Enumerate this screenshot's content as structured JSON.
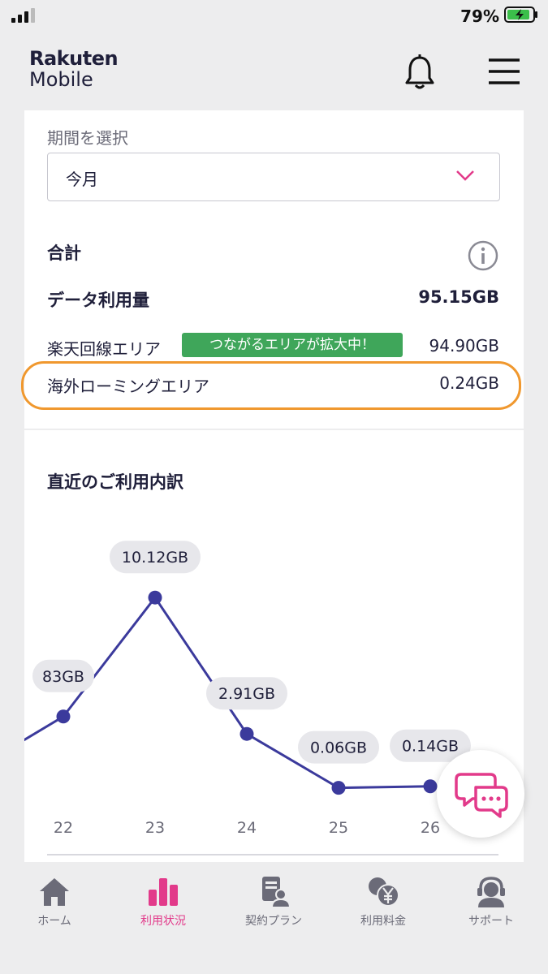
{
  "status_bar": {
    "battery_percent": "79%"
  },
  "header": {
    "logo_line1": "Rakuten",
    "logo_line2": "Mobile",
    "notification_icon": "bell-icon",
    "menu_icon": "hamburger-icon"
  },
  "summary": {
    "period_label": "期間を選択",
    "period_value": "今月",
    "total_label": "合計",
    "data_usage_label": "データ利用量",
    "data_usage_value": "95.15GB",
    "rakuten_area_label": "楽天回線エリア",
    "rakuten_area_badge": "つながるエリアが拡大中！",
    "rakuten_area_value": "94.90GB",
    "roaming_area_label": "海外ローミングエリア",
    "roaming_area_value": "0.24GB"
  },
  "recent": {
    "title": "直近のご利用内訳"
  },
  "chart_data": {
    "type": "line",
    "x": [
      "22",
      "23",
      "24",
      "25",
      "26"
    ],
    "values": [
      3.83,
      10.12,
      2.91,
      0.06,
      0.14
    ],
    "value_labels": [
      "83GB",
      "10.12GB",
      "2.91GB",
      "0.06GB",
      "0.14GB"
    ],
    "colors": {
      "line": "#3b3a9c",
      "label_bg": "#e7e7eb"
    }
  },
  "nav": {
    "items": [
      {
        "label": "ホーム",
        "icon": "home-icon",
        "active": false
      },
      {
        "label": "利用状況",
        "icon": "bar-chart-icon",
        "active": true
      },
      {
        "label": "契約プラン",
        "icon": "contract-icon",
        "active": false
      },
      {
        "label": "利用料金",
        "icon": "yen-coin-icon",
        "active": false
      },
      {
        "label": "サポート",
        "icon": "headset-icon",
        "active": false
      }
    ]
  },
  "colors": {
    "accent": "#e23a8a",
    "badge_green": "#3fa65a",
    "highlight_orange": "#f0982e",
    "navy": "#1f1f3a"
  }
}
